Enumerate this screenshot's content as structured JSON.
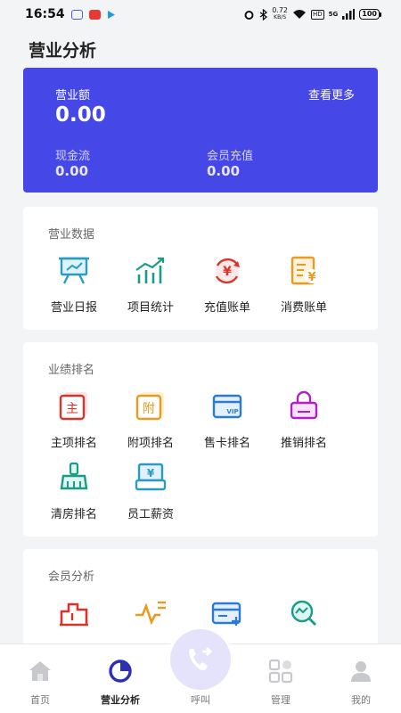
{
  "status_bar": {
    "time": "16:54",
    "net_speed_value": "0.72",
    "net_speed_unit": "KB/S",
    "hd": "HD",
    "signal": "5G",
    "battery": "100"
  },
  "page": {
    "title": "营业分析"
  },
  "summary": {
    "revenue_label": "营业额",
    "revenue_value": "0.00",
    "more_label": "查看更多",
    "cash_label": "现金流",
    "cash_value": "0.00",
    "member_label": "会员充值",
    "member_value": "0.00",
    "accent_color": "#4548e6"
  },
  "sections": {
    "business": {
      "title": "营业数据",
      "items": [
        {
          "label": "营业日报",
          "icon": "chart-board-icon"
        },
        {
          "label": "项目统计",
          "icon": "bar-chart-icon"
        },
        {
          "label": "充值账单",
          "icon": "yen-cycle-icon"
        },
        {
          "label": "消费账单",
          "icon": "yen-bill-icon"
        }
      ]
    },
    "ranking": {
      "title": "业绩排名",
      "items": [
        {
          "label": "主项排名",
          "icon": "main-item-icon",
          "glyph": "主"
        },
        {
          "label": "附项排名",
          "icon": "sub-item-icon",
          "glyph": "附"
        },
        {
          "label": "售卡排名",
          "icon": "vip-card-icon",
          "glyph": "VIP"
        },
        {
          "label": "推销排名",
          "icon": "shopping-bag-icon"
        },
        {
          "label": "清房排名",
          "icon": "broom-icon"
        },
        {
          "label": "员工薪资",
          "icon": "salary-icon",
          "glyph": "¥"
        }
      ]
    },
    "member": {
      "title": "会员分析",
      "items": [
        {
          "icon": "stats-icon"
        },
        {
          "icon": "pulse-icon"
        },
        {
          "icon": "card-add-icon"
        },
        {
          "icon": "trend-search-icon"
        }
      ]
    }
  },
  "tab_bar": {
    "home": "首页",
    "analysis": "营业分析",
    "call": "呼叫",
    "manage": "管理",
    "mine": "我的"
  }
}
